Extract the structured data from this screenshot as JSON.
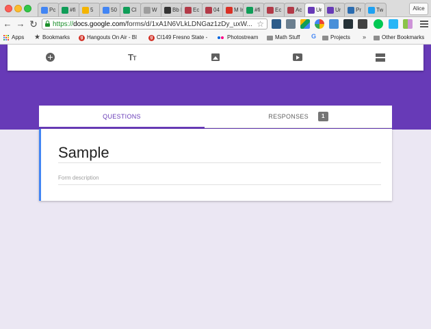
{
  "browser": {
    "tabs": [
      {
        "label": "Pc",
        "color": "#4285f4"
      },
      {
        "label": "#fi",
        "color": "#0f9d58"
      },
      {
        "label": "5",
        "color": "#f4b400"
      },
      {
        "label": "50",
        "color": "#4285f4"
      },
      {
        "label": "Cl",
        "color": "#0f9d58"
      },
      {
        "label": "W",
        "color": "#9e9e9e"
      },
      {
        "label": "Bb Pr",
        "color": "#333333"
      },
      {
        "label": "Ec",
        "color": "#b23a48"
      },
      {
        "label": "04",
        "color": "#b23a48"
      },
      {
        "label": "M In",
        "color": "#d93025"
      },
      {
        "label": "#fi",
        "color": "#0f9d58"
      },
      {
        "label": "Ec",
        "color": "#b23a48"
      },
      {
        "label": "Ac",
        "color": "#b23a48"
      },
      {
        "label": "Ur",
        "color": "#673ab7",
        "active": true
      },
      {
        "label": "Ur",
        "color": "#673ab7"
      },
      {
        "label": "Pr",
        "color": "#2b6cb0"
      },
      {
        "label": "Tw",
        "color": "#1da1f2"
      }
    ],
    "profile_name": "Alice",
    "url_scheme": "https://",
    "url_domain": "docs.google.com",
    "url_path": "/forms/d/1xA1N6VLkLDNGaz1zDy_uxW...",
    "bookmarks": [
      {
        "label": "Apps",
        "icon": "apps-icon"
      },
      {
        "label": "Bookmarks",
        "icon": "star-icon"
      },
      {
        "label": "Hangouts On Air - Bl",
        "icon": "google-plus-icon"
      },
      {
        "label": "CI149 Fresno State -",
        "icon": "google-plus-icon"
      },
      {
        "label": "Photostream",
        "icon": "flickr-icon"
      },
      {
        "label": "Math Stuff",
        "icon": "folder-icon"
      },
      {
        "label": "Projects",
        "icon": "folder-icon"
      },
      {
        "label": "Other Bookmarks",
        "icon": "folder-icon"
      }
    ],
    "overflow_chevron": "»"
  },
  "form": {
    "tab_questions": "QUESTIONS",
    "tab_responses": "RESPONSES",
    "responses_count": "1",
    "title": "Sample",
    "description_placeholder": "Form description",
    "accent_color": "#673ab7",
    "card_accent_color": "#4285f4"
  }
}
